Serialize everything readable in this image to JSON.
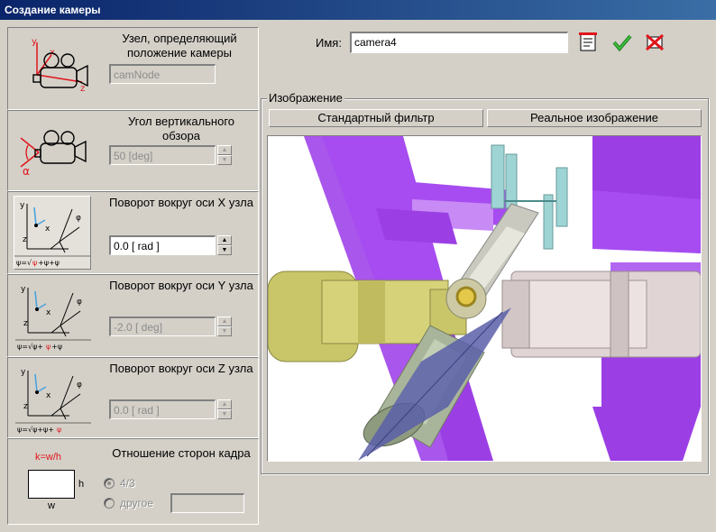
{
  "window": {
    "title": "Создание камеры"
  },
  "left": {
    "node": {
      "label": "Узел, определяющий положение камеры",
      "value": "camNode"
    },
    "fov": {
      "label": "Угол вертикального обзора",
      "value": "50 [deg]"
    },
    "rotx": {
      "label": "Поворот вокруг оси X узла",
      "value": "0.0 [ rad ]"
    },
    "roty": {
      "label": "Поворот вокруг оси Y узла",
      "value": "-2.0 [ deg]"
    },
    "rotz": {
      "label": "Поворот вокруг оси Z узла",
      "value": "0.0 [ rad ]"
    },
    "aspect": {
      "label": "Отношение сторон кадра",
      "formula": "k=w/h",
      "h": "h",
      "w": "w",
      "option1": "4/3",
      "option2": "другое",
      "other_value": ""
    },
    "icon_labels": {
      "y": "y",
      "x": "x",
      "z": "z",
      "alpha": "α",
      "phi": "φ"
    }
  },
  "right": {
    "name_label": "Имя:",
    "name_value": "camera4",
    "group_title": "Изображение",
    "tab1": "Стандартный фильтр",
    "tab2": "Реальное изображение"
  },
  "icons": [
    "notepad-icon",
    "ok-check-icon",
    "cancel-x-icon",
    "camera-axes-icon",
    "camera-angle-icon",
    "rotation-axes-icon"
  ],
  "colors": {
    "title_bar": "#0a246a",
    "accent_red": "#e0151b",
    "ok_green": "#2ea62e",
    "panels_purple": "#9a3ce6"
  }
}
